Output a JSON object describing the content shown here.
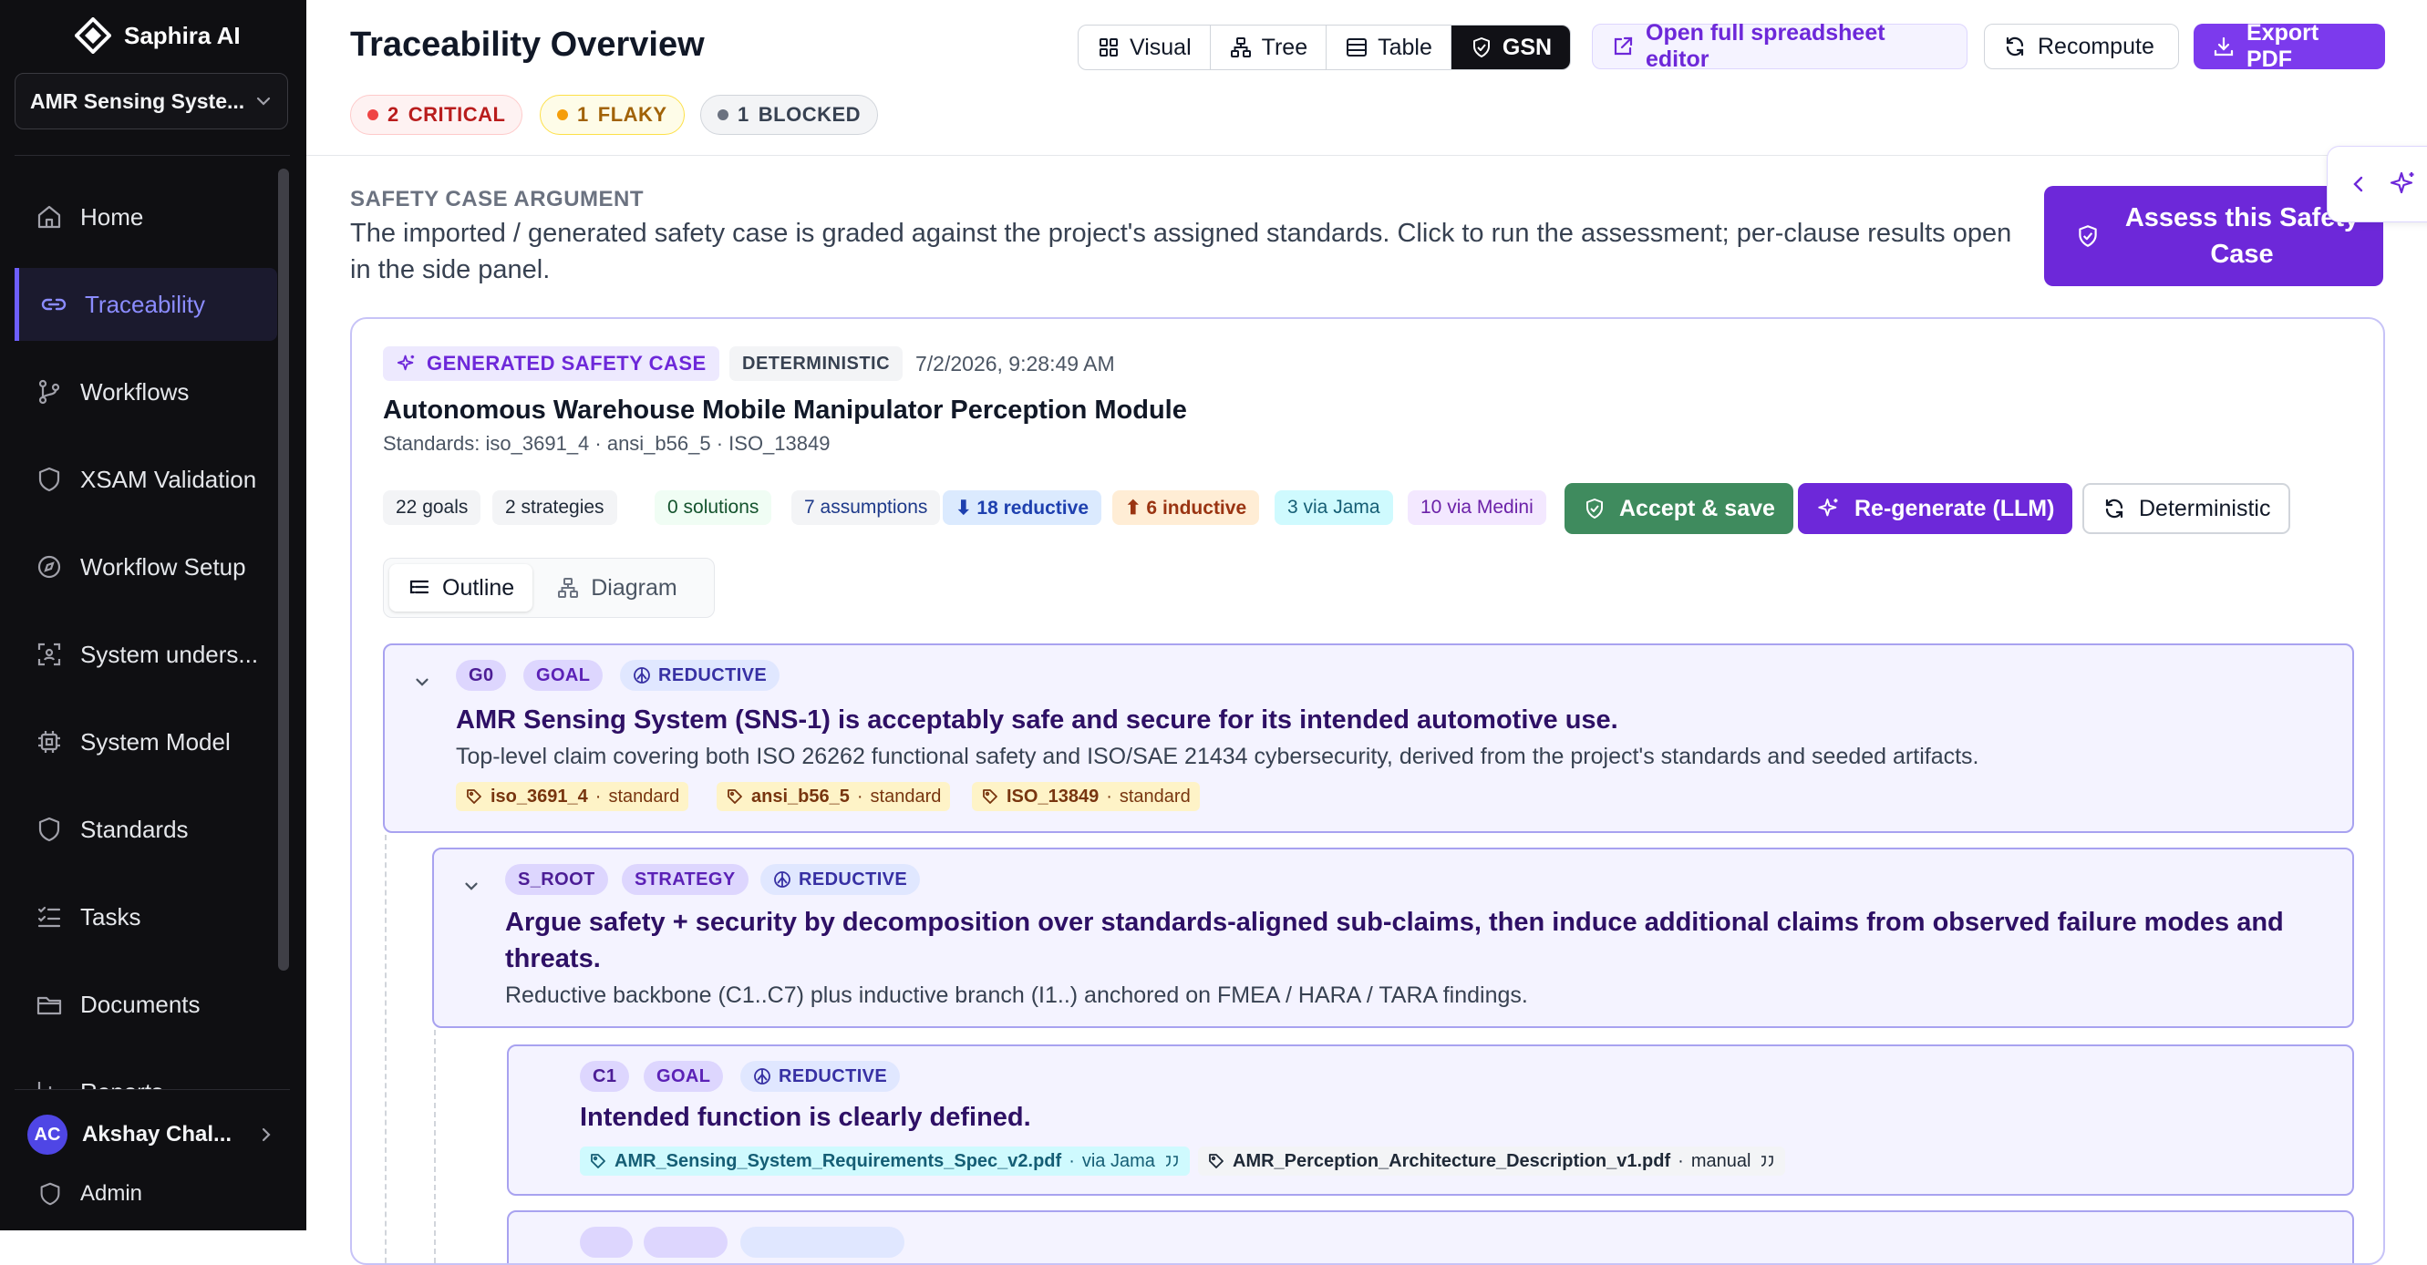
{
  "sidebar": {
    "brand": "Saphira AI",
    "project": "AMR Sensing Syste...",
    "items": [
      {
        "label": "Home",
        "icon": "home-icon"
      },
      {
        "label": "Traceability",
        "icon": "link-icon",
        "active": true
      },
      {
        "label": "Workflows",
        "icon": "git-branch-icon"
      },
      {
        "label": "XSAM Validation",
        "icon": "shield-icon"
      },
      {
        "label": "Workflow Setup",
        "icon": "compass-icon"
      },
      {
        "label": "System unders...",
        "icon": "scan-icon"
      },
      {
        "label": "System Model",
        "icon": "cpu-icon"
      },
      {
        "label": "Standards",
        "icon": "shield-icon"
      },
      {
        "label": "Tasks",
        "icon": "list-checks-icon"
      },
      {
        "label": "Documents",
        "icon": "folder-icon"
      },
      {
        "label": "Reports",
        "icon": "chart-icon"
      }
    ],
    "user": {
      "initials": "AC",
      "name": "Akshay Chal..."
    },
    "admin": "Admin"
  },
  "header": {
    "title": "Traceability Overview",
    "views": [
      "Visual",
      "Tree",
      "Table",
      "GSN"
    ],
    "active_view": "GSN",
    "open_spreadsheet": "Open full spreadsheet editor",
    "recompute": "Recompute",
    "export_pdf": "Export PDF",
    "status": {
      "critical": {
        "count": "2",
        "label": "CRITICAL"
      },
      "flaky": {
        "count": "1",
        "label": "FLAKY"
      },
      "blocked": {
        "count": "1",
        "label": "BLOCKED"
      }
    }
  },
  "safety_case": {
    "heading": "SAFETY CASE ARGUMENT",
    "description": "The imported / generated safety case is graded against the project's assigned standards. Click to run the assessment; per-clause results open in the side panel.",
    "assess_button": "Assess this Safety Case"
  },
  "card": {
    "type_tag": "GENERATED SAFETY CASE",
    "mode_tag": "DETERMINISTIC",
    "timestamp": "7/2/2026, 9:28:49 AM",
    "title": "Autonomous Warehouse Mobile Manipulator Perception Module",
    "standards": "Standards: iso_3691_4 · ansi_b56_5 · ISO_13849",
    "stats": {
      "goals": "22 goals",
      "strategies": "2 strategies",
      "solutions": "0 solutions",
      "assumptions": "7 assumptions",
      "reductive": "⬇ 18 reductive",
      "inductive": "⬆ 6 inductive",
      "jama": "3 via Jama",
      "medini": "10 via Medini"
    },
    "accept_button": "Accept & save",
    "regenerate_button": "Re-generate (LLM)",
    "deterministic_button": "Deterministic",
    "tabs": {
      "outline": "Outline",
      "diagram": "Diagram"
    }
  },
  "nodes": {
    "g0": {
      "id": "G0",
      "kind": "GOAL",
      "direction": "REDUCTIVE",
      "title": "AMR Sensing System (SNS-1) is acceptably safe and secure for its intended automotive use.",
      "description": "Top-level claim covering both ISO 26262 functional safety and ISO/SAE 21434 cybersecurity, derived from the project's standards and seeded artifacts.",
      "refs": [
        {
          "name": "iso_3691_4",
          "type": "standard"
        },
        {
          "name": "ansi_b56_5",
          "type": "standard"
        },
        {
          "name": "ISO_13849",
          "type": "standard"
        }
      ]
    },
    "s_root": {
      "id": "S_ROOT",
      "kind": "STRATEGY",
      "direction": "REDUCTIVE",
      "title": "Argue safety + security by decomposition over standards-aligned sub-claims, then induce additional claims from observed failure modes and threats.",
      "description": "Reductive backbone (C1..C7) plus inductive branch (I1..) anchored on FMEA / HARA / TARA findings."
    },
    "c1": {
      "id": "C1",
      "kind": "GOAL",
      "direction": "REDUCTIVE",
      "title": "Intended function is clearly defined.",
      "refs": [
        {
          "name": "AMR_Sensing_System_Requirements_Spec_v2.pdf",
          "source": "via Jama"
        },
        {
          "name": "AMR_Perception_Architecture_Description_v1.pdf",
          "source": "manual"
        }
      ]
    }
  },
  "colors": {
    "accent": "#6d28d9",
    "sidebar_bg": "#0f0f12",
    "node_border": "#a8a2f0",
    "node_bg": "#f4f3ff",
    "accept": "#3f8b5e"
  }
}
